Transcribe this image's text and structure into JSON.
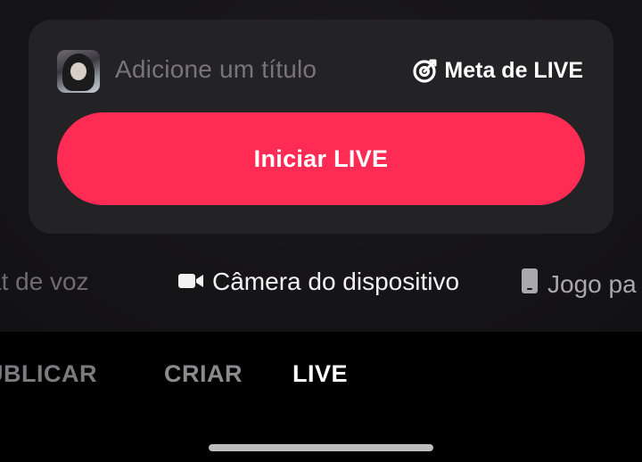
{
  "card": {
    "title_placeholder": "Adicione um título",
    "goal_label": "Meta de LIVE",
    "start_button_label": "Iniciar LIVE"
  },
  "sources": {
    "voice_chat": "at de voz",
    "device_camera": "Câmera do dispositivo",
    "game": "Jogo pa"
  },
  "nav": {
    "tabs": [
      {
        "label": "UBLICAR"
      },
      {
        "label": "CRIAR"
      },
      {
        "label": "LIVE"
      }
    ],
    "active_tab": "LIVE"
  },
  "colors": {
    "start_button": "#fe2c55",
    "card_background": "#232225",
    "placeholder_text": "#77757a"
  },
  "icons": {
    "goal": "target-icon",
    "camera": "video-camera-icon",
    "game": "phone-icon"
  }
}
